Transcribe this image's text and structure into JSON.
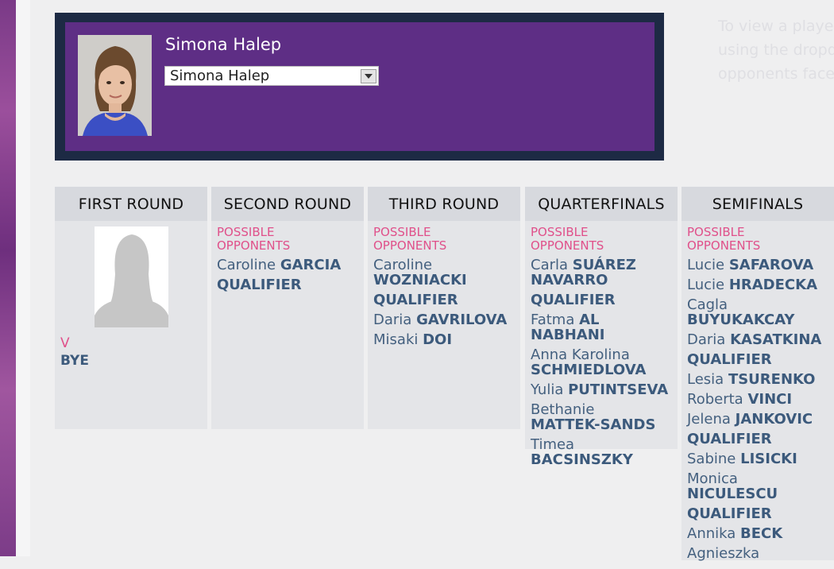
{
  "player": {
    "name": "Simona Halep",
    "select_value": "Simona Halep"
  },
  "info_text": [
    "To view a player",
    "using the dropdo",
    "opponents faced"
  ],
  "rounds": [
    {
      "title": "FIRST ROUND",
      "vs_label": "V",
      "opponent": "BYE"
    },
    {
      "title": "SECOND ROUND",
      "possible_label_1": "POSSIBLE",
      "possible_label_2": "OPPONENTS",
      "opponents": [
        {
          "first": "Caroline",
          "last": "GARCIA"
        },
        {
          "first": "",
          "last": "QUALIFIER"
        }
      ]
    },
    {
      "title": "THIRD ROUND",
      "possible_label_1": "POSSIBLE",
      "possible_label_2": "OPPONENTS",
      "opponents": [
        {
          "first": "Caroline",
          "last": "WOZNIACKI"
        },
        {
          "first": "",
          "last": "QUALIFIER"
        },
        {
          "first": "Daria",
          "last": "GAVRILOVA"
        },
        {
          "first": "Misaki",
          "last": "DOI"
        }
      ]
    },
    {
      "title": "QUARTERFINALS",
      "possible_label_1": "POSSIBLE",
      "possible_label_2": "OPPONENTS",
      "opponents": [
        {
          "first": "Carla",
          "last": "SUÁREZ NAVARRO"
        },
        {
          "first": "",
          "last": "QUALIFIER"
        },
        {
          "first": "Fatma",
          "last": "AL NABHANI"
        },
        {
          "first": "Anna Karolina",
          "last": "SCHMIEDLOVA"
        },
        {
          "first": "Yulia",
          "last": "PUTINTSEVA"
        },
        {
          "first": "Bethanie",
          "last": "MATTEK-SANDS"
        },
        {
          "first": "Timea",
          "last": "BACSINSZKY"
        }
      ]
    },
    {
      "title": "SEMIFINALS",
      "possible_label_1": "POSSIBLE",
      "possible_label_2": "OPPONENTS",
      "opponents": [
        {
          "first": "Lucie",
          "last": "SAFAROVA"
        },
        {
          "first": "Lucie",
          "last": "HRADECKA"
        },
        {
          "first": "Cagla",
          "last": "BUYUKAKCAY"
        },
        {
          "first": "Daria",
          "last": "KASATKINA"
        },
        {
          "first": "",
          "last": "QUALIFIER"
        },
        {
          "first": "Lesia",
          "last": "TSURENKO"
        },
        {
          "first": "Roberta",
          "last": "VINCI"
        },
        {
          "first": "Jelena",
          "last": "JANKOVIC"
        },
        {
          "first": "",
          "last": "QUALIFIER"
        },
        {
          "first": "Sabine",
          "last": "LISICKI"
        },
        {
          "first": "Monica",
          "last": "NICULESCU"
        },
        {
          "first": "",
          "last": "QUALIFIER"
        },
        {
          "first": "Annika",
          "last": "BECK"
        },
        {
          "first": "Agnieszka",
          "last": ""
        }
      ]
    }
  ],
  "colors": {
    "player_panel": "#5e2e85",
    "player_frame": "#1d2a44",
    "accent_pink": "#e0508a",
    "name_blue": "#3c5a7c"
  }
}
